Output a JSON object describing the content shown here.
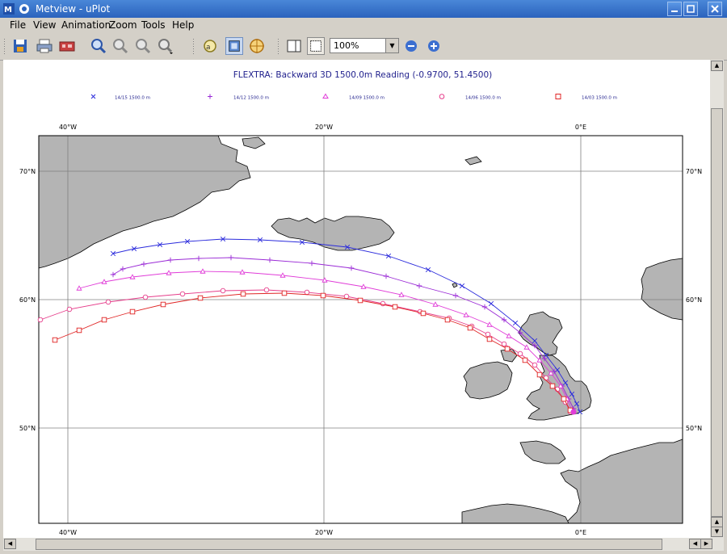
{
  "window": {
    "title": "Metview - uPlot"
  },
  "menu": [
    "File",
    "View",
    "Animation",
    "Zoom",
    "Tools",
    "Help"
  ],
  "toolbar": {
    "zoom_value": "100%"
  },
  "plot": {
    "title": "FLEXTRA: Backward 3D 1500.0m Reading (-0.9700, 51.4500)",
    "legend": [
      "14/15 1500.0 m",
      "14/12 1500.0 m",
      "14/09 1500.0 m",
      "14/06 1500.0 m",
      "14/03 1500.0 m"
    ],
    "lon_labels": [
      "40°W",
      "20°W",
      "0°E"
    ],
    "lat_labels": [
      "70°N",
      "60°N",
      "50°N"
    ],
    "colors": {
      "land": "#b4b4b4",
      "grid": "#808080",
      "t15": "#2b2bdc",
      "t12": "#9a2ad6",
      "t09": "#e03cd8",
      "t06": "#e63c8a",
      "t03": "#e02424"
    }
  }
}
